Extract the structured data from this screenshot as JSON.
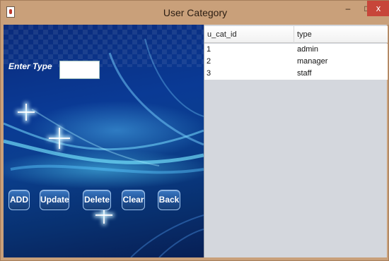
{
  "window": {
    "title": "User Category",
    "minimize_glyph": "–",
    "maximize_glyph": "□",
    "close_glyph": "x"
  },
  "form": {
    "type_label": "Enter Type",
    "type_value": "",
    "buttons": {
      "add": "ADD",
      "update": "Update",
      "delete": "Delete",
      "clear": "Clear",
      "back": "Back"
    }
  },
  "table": {
    "columns": [
      "u_cat_id",
      "type"
    ],
    "rows": [
      {
        "id": "1",
        "type": "admin"
      },
      {
        "id": "2",
        "type": "manager"
      },
      {
        "id": "3",
        "type": "staff"
      }
    ]
  },
  "colors": {
    "title_bar": "#c9a07a",
    "close_button": "#c7463a",
    "panel_blue": "#0a3a95",
    "button_blue": "#1f4f93",
    "table_empty": "#d4d7dd"
  }
}
